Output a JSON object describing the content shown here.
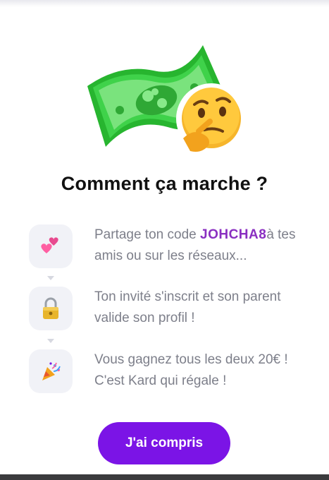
{
  "modal": {
    "title": "Comment ça marche ?",
    "hero_icons": [
      "money-bill-icon",
      "thinking-face-icon"
    ]
  },
  "steps": [
    {
      "icon": "two-hearts-icon",
      "text_before": "Partage ton code ",
      "code": "JOHCHA8",
      "text_after": "à tes amis ou sur les réseaux..."
    },
    {
      "icon": "padlock-icon",
      "text": "Ton invité s'inscrit et son parent valide son profil !"
    },
    {
      "icon": "party-popper-icon",
      "text": "Vous gagnez tous les deux 20€ ! C'est Kard qui régale !"
    }
  ],
  "cta": {
    "label": "J'ai compris"
  },
  "colors": {
    "accent": "#7b14e6",
    "code": "#8a2fc1",
    "step_text": "#7d7f8a",
    "bubble_bg": "#f1f2f7",
    "title": "#111111"
  }
}
